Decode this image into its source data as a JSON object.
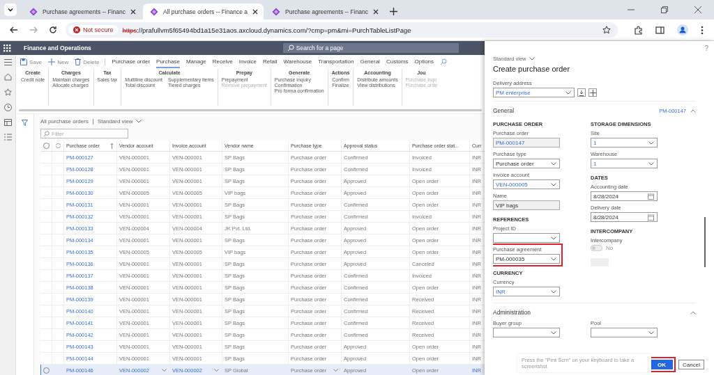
{
  "browser": {
    "tabs": [
      {
        "title": "Purchase agreements -- Financ",
        "selected": false
      },
      {
        "title": "All purchase orders -- Finance a",
        "selected": true
      },
      {
        "title": "Purchase agreements -- Financ",
        "selected": false
      }
    ],
    "security": "Not secure",
    "url_scheme": "https",
    "url_rest": "://prafullvm5f65494bd1a15e31aos.axcloud.dynamics.com/?cmp=pm&mi=PurchTableListPage"
  },
  "app": {
    "title": "Finance and Operations",
    "search_placeholder": "Search for a page",
    "actions": [
      {
        "label": "Save",
        "kind": "save"
      },
      {
        "label": "New",
        "kind": "new"
      },
      {
        "label": "Delete",
        "kind": "delete"
      },
      {
        "label": "Purchase order",
        "kind": "tab",
        "selected": false
      },
      {
        "label": "Purchase",
        "kind": "tab",
        "selected": true
      },
      {
        "label": "Manage",
        "kind": "tab",
        "selected": false
      },
      {
        "label": "Receive",
        "kind": "tab",
        "selected": false
      },
      {
        "label": "Invoice",
        "kind": "tab",
        "selected": false
      },
      {
        "label": "Retail",
        "kind": "tab",
        "selected": false
      },
      {
        "label": "Warehouse",
        "kind": "tab",
        "selected": false
      },
      {
        "label": "Transportation",
        "kind": "tab",
        "selected": false
      },
      {
        "label": "General",
        "kind": "tab",
        "selected": false
      },
      {
        "label": "Customs",
        "kind": "tab",
        "selected": false
      },
      {
        "label": "Options",
        "kind": "tab",
        "selected": false
      }
    ],
    "ribbon": [
      {
        "title": "Create",
        "columns": [
          [
            {
              "label": "Credit note",
              "disabled": false
            }
          ]
        ]
      },
      {
        "title": "Charges",
        "columns": [
          [
            {
              "label": "Maintain charges",
              "disabled": false
            },
            {
              "label": "Allocate charges",
              "disabled": false
            }
          ]
        ]
      },
      {
        "title": "Tax",
        "columns": [
          [
            {
              "label": "Sales tax",
              "disabled": false
            }
          ]
        ]
      },
      {
        "title": "Calculate",
        "columns": [
          [
            {
              "label": "Multiline discount",
              "disabled": false
            },
            {
              "label": "Total discount",
              "disabled": false
            }
          ],
          [
            {
              "label": "Supplementary items",
              "disabled": false
            },
            {
              "label": "Tiered charges",
              "disabled": false
            }
          ]
        ]
      },
      {
        "title": "Prepay",
        "columns": [
          [
            {
              "label": "Prepayment",
              "disabled": false
            },
            {
              "label": "Remove prepayment",
              "disabled": true
            }
          ]
        ]
      },
      {
        "title": "Generate",
        "columns": [
          [
            {
              "label": "Purchase inquiry",
              "disabled": false
            },
            {
              "label": "Confirmation",
              "disabled": false
            },
            {
              "label": "Pro forma confirmation",
              "disabled": false
            }
          ]
        ]
      },
      {
        "title": "Actions",
        "columns": [
          [
            {
              "label": "Confirm",
              "disabled": false
            },
            {
              "label": "Finalize",
              "disabled": false
            }
          ]
        ]
      },
      {
        "title": "Accounting",
        "columns": [
          [
            {
              "label": "Distribute amounts",
              "disabled": false
            },
            {
              "label": "View distributions",
              "disabled": false
            }
          ]
        ]
      },
      {
        "title": "Jou",
        "columns": [
          [
            {
              "label": "Purchase inqu",
              "disabled": true
            },
            {
              "label": "Purchase orde",
              "disabled": true
            }
          ]
        ]
      }
    ],
    "select_all": false,
    "breadcrumb": "All purchase orders",
    "view": "Standard view",
    "filter_placeholder": "Filter",
    "columns": [
      "Purchase order",
      "Vendor account",
      "Invoice account",
      "Vendor name",
      "Purchase type",
      "Approval status",
      "Purchase order stat...",
      "Curr"
    ],
    "rows": [
      {
        "cells": [
          "PM-000127",
          "VEN-000001",
          "VEN-000001",
          "SP Bags",
          "Purchase order",
          "Confirmed",
          "Invoiced",
          "INR"
        ],
        "selected": false
      },
      {
        "cells": [
          "PM-000128",
          "VEN-000001",
          "VEN-000001",
          "SP Bags",
          "Purchase order",
          "Confirmed",
          "Invoiced",
          "INR"
        ],
        "selected": false
      },
      {
        "cells": [
          "PM-000129",
          "VEN-000001",
          "VEN-000001",
          "SP Bags",
          "Purchase order",
          "Approved",
          "Open order",
          "INR"
        ],
        "selected": false
      },
      {
        "cells": [
          "PM-000130",
          "VEN-000005",
          "VEN-000005",
          "VIP bags",
          "Purchase order",
          "Approved",
          "Open order",
          "INR"
        ],
        "selected": false
      },
      {
        "cells": [
          "PM-000131",
          "VEN-000001",
          "VEN-000001",
          "SP Bags",
          "Purchase order",
          "Confirmed",
          "Open order",
          "INR"
        ],
        "selected": false
      },
      {
        "cells": [
          "PM-000132",
          "VEN-000001",
          "VEN-000001",
          "SP Bags",
          "Purchase order",
          "Confirmed",
          "Invoiced",
          "INR"
        ],
        "selected": false
      },
      {
        "cells": [
          "PM-000133",
          "VEN-000004",
          "VEN-000004",
          "JK Pvt. Ltd.",
          "Purchase order",
          "Approved",
          "Open order",
          "INR"
        ],
        "selected": false
      },
      {
        "cells": [
          "PM-000134",
          "VEN-000001",
          "VEN-000001",
          "SP Bags",
          "Purchase order",
          "Approved",
          "Open order",
          "INR"
        ],
        "selected": false
      },
      {
        "cells": [
          "PM-000135",
          "VEN-000005",
          "VEN-000005",
          "VIP bags",
          "Purchase order",
          "Approved",
          "Open order",
          "INR"
        ],
        "selected": false
      },
      {
        "cells": [
          "PM-000136",
          "VEN-000001",
          "VEN-000001",
          "SP Bags",
          "Purchase order",
          "Approved",
          "Canceled",
          "INR"
        ],
        "selected": false
      },
      {
        "cells": [
          "PM-000137",
          "VEN-000001",
          "VEN-000001",
          "SP Bags",
          "Purchase order",
          "Confirmed",
          "Invoiced",
          "INR"
        ],
        "selected": false
      },
      {
        "cells": [
          "PM-000138",
          "VEN-000001",
          "VEN-000001",
          "SP Bags",
          "Purchase order",
          "Confirmed",
          "Open order",
          "INR"
        ],
        "selected": false
      },
      {
        "cells": [
          "PM-000139",
          "VEN-000001",
          "VEN-000001",
          "SP Bags",
          "Purchase order",
          "Confirmed",
          "Received",
          "INR"
        ],
        "selected": false
      },
      {
        "cells": [
          "PM-000140",
          "VEN-000001",
          "VEN-000001",
          "SP Bags",
          "Purchase order",
          "Confirmed",
          "Received",
          "INR"
        ],
        "selected": false
      },
      {
        "cells": [
          "PM-000141",
          "VEN-000001",
          "VEN-000001",
          "SP Bags",
          "Purchase order",
          "Confirmed",
          "Received",
          "INR"
        ],
        "selected": false
      },
      {
        "cells": [
          "PM-000142",
          "VEN-000001",
          "VEN-000001",
          "SP Bags",
          "Purchase order",
          "Confirmed",
          "Received",
          "INR"
        ],
        "selected": false
      },
      {
        "cells": [
          "PM-000143",
          "VEN-000001",
          "VEN-000001",
          "SP Bags",
          "Purchase order",
          "Approved",
          "Open order",
          "INR"
        ],
        "selected": false
      },
      {
        "cells": [
          "PM-000144",
          "VEN-000001",
          "VEN-000001",
          "SP Bags",
          "Purchase order",
          "Approved",
          "Open order",
          "INR"
        ],
        "selected": false
      },
      {
        "cells": [
          "PM-000146",
          "VEN-000002",
          "VEN-000002",
          "SP Global",
          "Purchase order",
          "Approved",
          "Open order",
          "INR"
        ],
        "selected": true
      }
    ]
  },
  "panel": {
    "help": "?",
    "view": "Standard view",
    "title": "Create purchase order",
    "delivery_address": {
      "label": "Delivery address",
      "value": "PM enterprise"
    },
    "general": {
      "title": "General",
      "summary": "PM-000147",
      "expanded": true,
      "left": [
        {
          "heading": "PURCHASE ORDER",
          "fields": [
            {
              "label": "Purchase order",
              "value": "PM-000147",
              "kind": "readonly",
              "link": true,
              "highlighted": false
            },
            {
              "label": "Purchase type",
              "value": "Purchase order",
              "kind": "dropdown",
              "link": false,
              "highlighted": false
            },
            {
              "label": "Invoice account",
              "value": "VEN-000005",
              "kind": "dropdown",
              "link": true,
              "highlighted": false
            },
            {
              "label": "Name",
              "value": "VIP bags",
              "kind": "readonly",
              "link": false,
              "highlighted": false
            }
          ]
        },
        {
          "heading": "REFERENCES",
          "fields": [
            {
              "label": "Project ID",
              "kind": "dropdown",
              "highlighted": false
            },
            {
              "label": "Purchase agreement",
              "value": "PM-000035",
              "kind": "dropdown",
              "link": false,
              "highlighted": true
            }
          ]
        },
        {
          "heading": "CURRENCY",
          "fields": [
            {
              "label": "Currency",
              "value": "INR",
              "kind": "dropdown",
              "link": true,
              "highlighted": false
            }
          ]
        }
      ],
      "right": [
        {
          "heading": "STORAGE DIMENSIONS",
          "fields": [
            {
              "label": "Site",
              "value": "1",
              "kind": "dropdown",
              "link": true,
              "highlighted": false
            },
            {
              "label": "Warehouse",
              "value": "1",
              "kind": "dropdown",
              "link": true,
              "highlighted": false
            }
          ]
        },
        {
          "heading": "DATES",
          "fields": [
            {
              "label": "Accounting date",
              "value": "8/28/2024",
              "kind": "date",
              "link": false,
              "highlighted": false
            },
            {
              "label": "Delivery date",
              "value": "8/28/2024",
              "kind": "date",
              "link": false,
              "highlighted": false
            }
          ]
        },
        {
          "heading": "INTERCOMPANY",
          "fields": [
            {
              "label": "Intercompany",
              "value": "No",
              "kind": "toggle",
              "on": false,
              "highlighted": false
            }
          ]
        }
      ]
    },
    "administration": {
      "title": "Administration",
      "expanded": true,
      "fields": [
        {
          "label": "Buyer group",
          "kind": "dropdown",
          "highlighted": false
        },
        {
          "label": "Pool",
          "kind": "dropdown",
          "highlighted": false
        }
      ]
    },
    "toast": "Press the \"Prnt Scrn\" on your keyboard to take a screenshot",
    "buttons": [
      {
        "label": "OK",
        "kind": "primary",
        "highlighted": true
      },
      {
        "label": "Cancel",
        "kind": "secondary",
        "highlighted": false
      }
    ]
  }
}
